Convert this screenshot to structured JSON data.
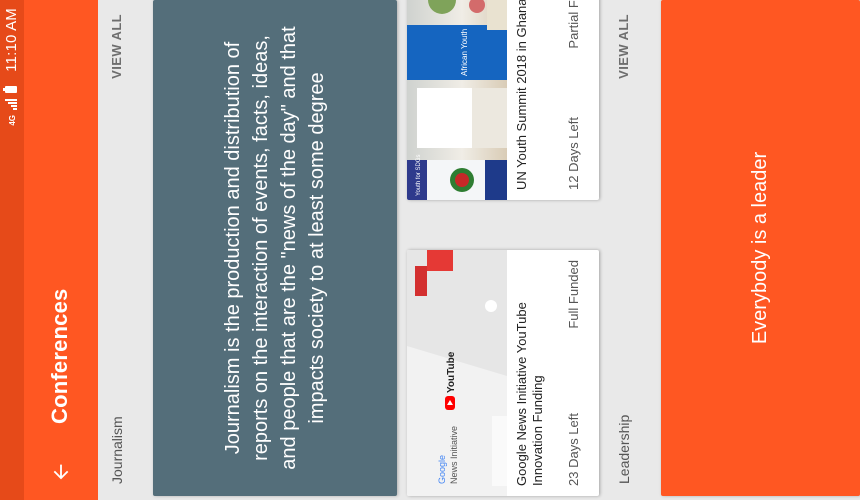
{
  "status_bar": {
    "time": "11:10 AM",
    "network": "4G",
    "battery_icon": "battery-icon",
    "signal_icon": "signal-icon"
  },
  "app_bar": {
    "title": "Conferences",
    "back_icon": "arrow-back-icon",
    "color": "#ff5722"
  },
  "sections": [
    {
      "title": "Journalism",
      "view_all": "VIEW ALL",
      "hero_text": "Journalism is the production and distribution of reports on the interaction of events, facts, ideas, and people that are the \"news of the day\" and that impacts society to at least some degree",
      "hero_color": "#546e7a",
      "cards": [
        {
          "title": "Google News Initiative YouTube Innovation Funding",
          "days_left": "23 Days Left",
          "funding": "Full Funded",
          "image": {
            "logo_left_1": "Google",
            "logo_left_2": "News Initiative",
            "logo_right": "YouTube"
          }
        },
        {
          "title": "UN Youth Summit 2018 in Ghana",
          "days_left": "12 Days Left",
          "funding": "Partial Funded",
          "image": {
            "banner_top": "Youth for SDGs",
            "banner_right": "African Youth"
          }
        }
      ]
    },
    {
      "title": "Leadership",
      "view_all": "VIEW ALL",
      "hero_text": "Everybody is a leader",
      "hero_color": "#ff5722"
    }
  ]
}
